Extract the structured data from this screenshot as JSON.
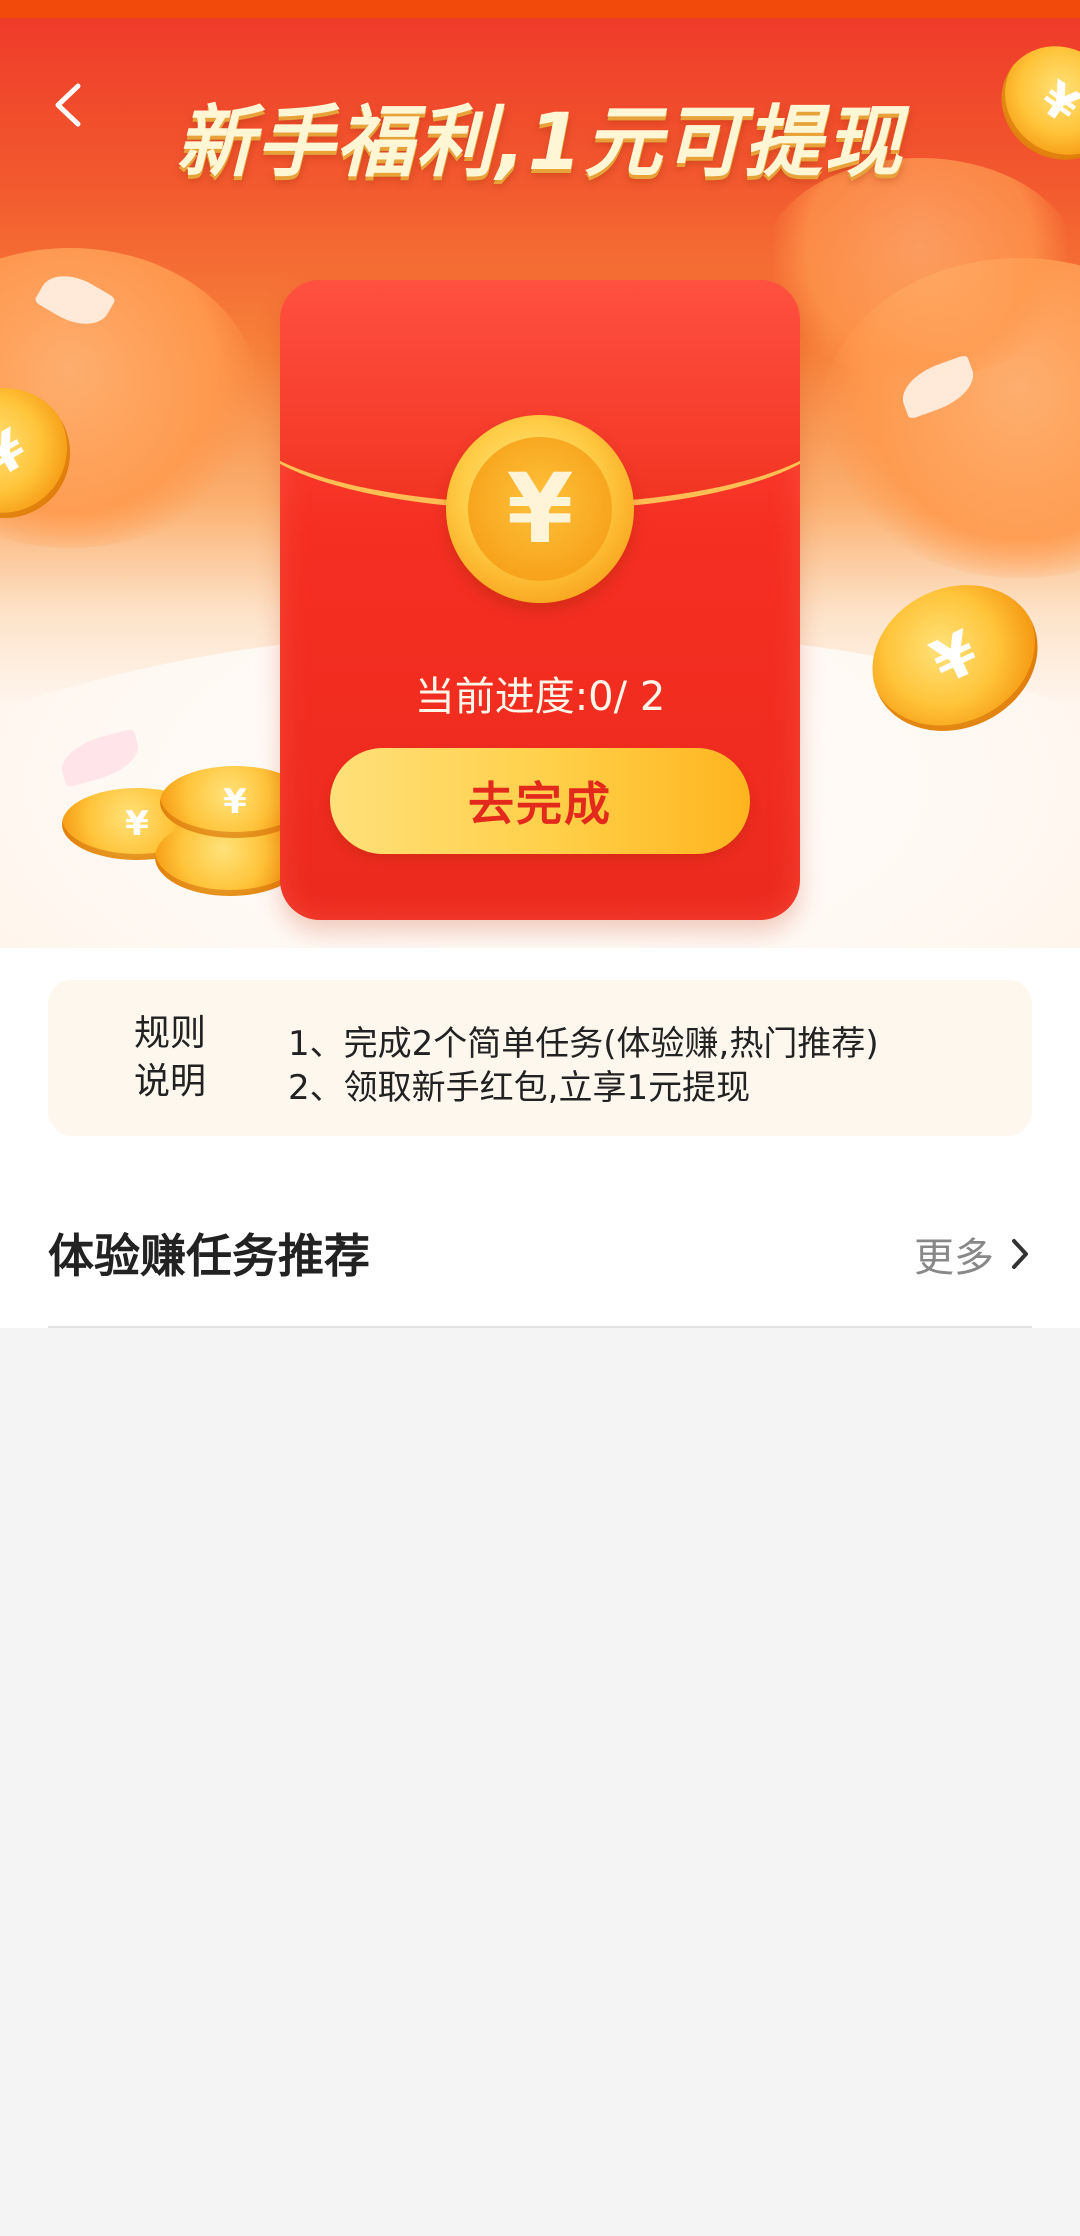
{
  "header": {
    "title": "新手福利,1元可提现",
    "back_icon": "chevron-left-icon"
  },
  "envelope": {
    "coin_symbol": "¥",
    "progress_label": "当前进度:0/ 2",
    "progress": {
      "current": 0,
      "total": 2
    },
    "cta_label": "去完成"
  },
  "rules": {
    "title_line1": "规则",
    "title_line2": "说明",
    "items": [
      "1、完成2个简单任务(体验赚,热门推荐)",
      "2、领取新手红包,立享1元提现"
    ]
  },
  "section": {
    "title": "体验赚任务推荐",
    "more_label": "更多",
    "more_icon": "chevron-right-icon"
  },
  "colors": {
    "brand_red": "#ef3b2a",
    "status_orange": "#f24a0a",
    "cta_yellow": "#ffcf47",
    "cta_text": "#e3281c",
    "rules_bg": "#fdf7ed"
  }
}
